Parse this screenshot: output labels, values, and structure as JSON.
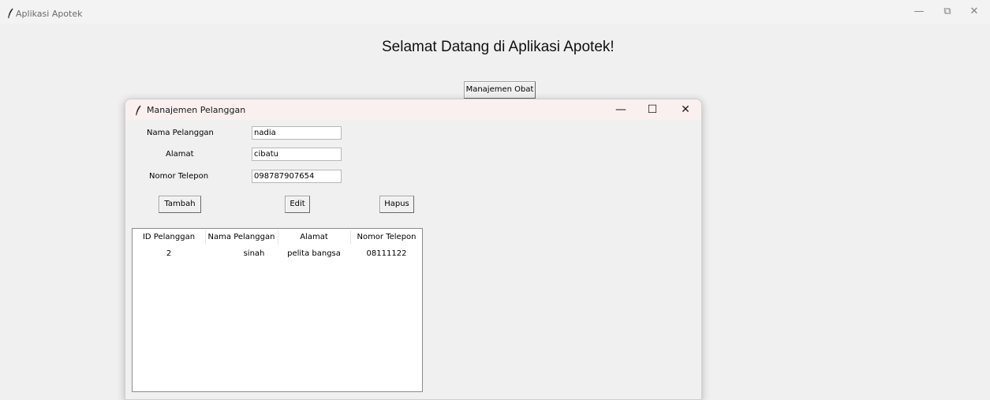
{
  "main_window": {
    "title": "Aplikasi Apotek",
    "welcome_text": "Selamat Datang di Aplikasi Apotek!",
    "manajemen_obat_label": "Manajemen Obat",
    "controls": {
      "minimize": "—",
      "restore": "⧉",
      "close": "✕"
    }
  },
  "child_window": {
    "title": "Manajemen Pelanggan",
    "controls": {
      "minimize": "—",
      "maximize": "☐",
      "close": "✕"
    },
    "form": {
      "nama_label": "Nama Pelanggan",
      "nama_value": "nadia",
      "alamat_label": "Alamat",
      "alamat_value": "cibatu",
      "telepon_label": "Nomor Telepon",
      "telepon_value": "098787907654"
    },
    "buttons": {
      "tambah": "Tambah",
      "edit": "Edit",
      "hapus": "Hapus"
    },
    "table": {
      "columns": [
        "ID Pelanggan",
        "Nama Pelanggan",
        "Alamat",
        "Nomor Telepon"
      ],
      "rows": [
        [
          "2",
          "sinah",
          "pelita bangsa",
          "08111122"
        ]
      ]
    }
  },
  "icons": {
    "app_icon": "feather-icon"
  }
}
